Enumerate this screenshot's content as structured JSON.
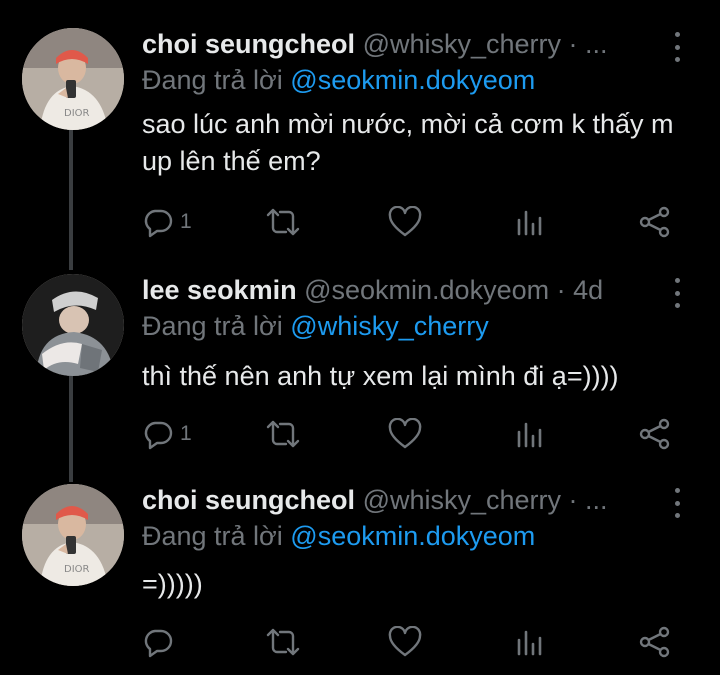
{
  "tweets": [
    {
      "name": "choi seungcheol",
      "handle": "@whisky_cherry",
      "time_sep": "·",
      "time": "...",
      "reply_prefix": "Đang trả lời",
      "reply_to": "@seokmin.dokyeom",
      "text": "sao lúc anh mời nước, mời cả cơm k thấy m up lên thế em?",
      "reply_count": "1"
    },
    {
      "name": "lee seokmin",
      "handle": "@seokmin.dokyeom",
      "time_sep": "·",
      "time": "4d",
      "reply_prefix": "Đang trả lời",
      "reply_to": "@whisky_cherry",
      "text": "thì thế nên anh tự xem lại mình đi ạ=))))",
      "reply_count": "1"
    },
    {
      "name": "choi seungcheol",
      "handle": "@whisky_cherry",
      "time_sep": "·",
      "time": "...",
      "reply_prefix": "Đang trả lời",
      "reply_to": "@seokmin.dokyeom",
      "text": "=)))))",
      "reply_count": ""
    }
  ],
  "icons": {
    "reply": "comment-bubble-icon",
    "retweet": "retweet-icon",
    "like": "heart-icon",
    "views": "analytics-bars-icon",
    "share": "share-icon",
    "more": "more-vertical-icon"
  },
  "colors": {
    "background": "#000000",
    "text": "#e7e9ea",
    "muted": "#71767b",
    "link": "#1d9bf0"
  }
}
